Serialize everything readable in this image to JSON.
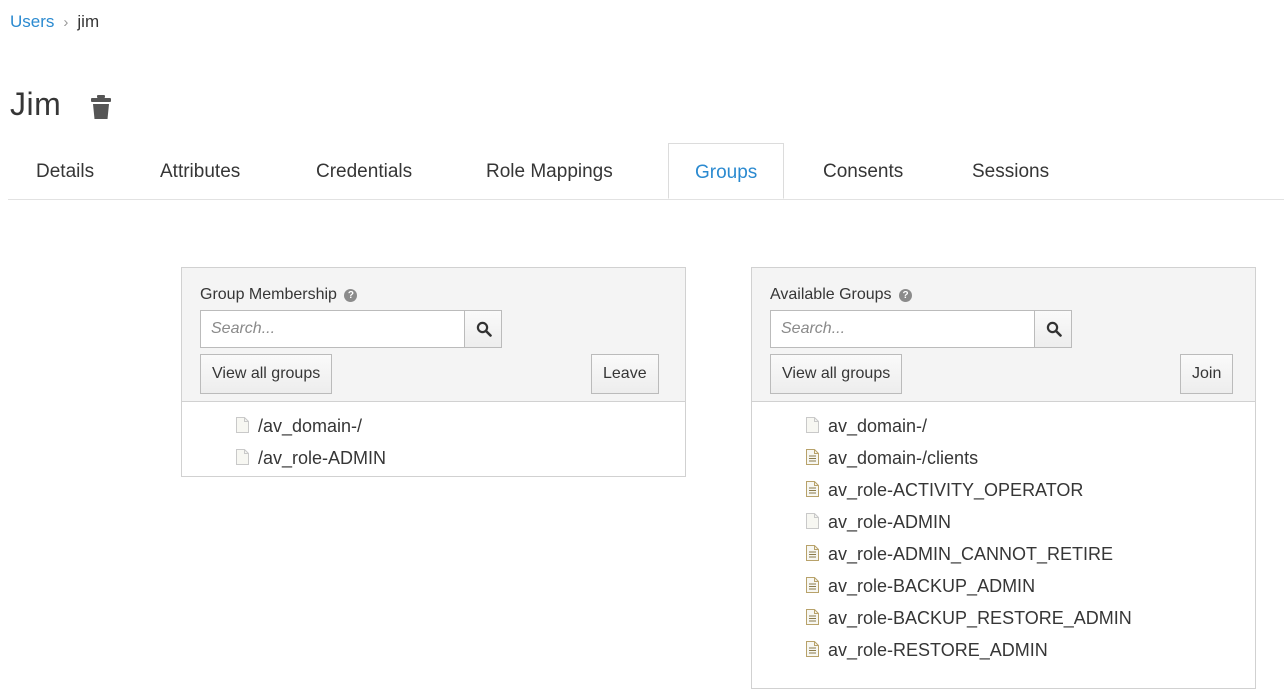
{
  "breadcrumb": {
    "parent": "Users",
    "separator": "›",
    "current": "jim"
  },
  "page": {
    "title": "Jim"
  },
  "tabs": [
    {
      "label": "Details"
    },
    {
      "label": "Attributes"
    },
    {
      "label": "Credentials"
    },
    {
      "label": "Role Mappings"
    },
    {
      "label": "Groups",
      "active": true
    },
    {
      "label": "Consents"
    },
    {
      "label": "Sessions"
    }
  ],
  "membership": {
    "title": "Group Membership",
    "help": "?",
    "search_placeholder": "Search...",
    "view_all_label": "View all groups",
    "action_label": "Leave",
    "items": [
      {
        "label": "/av_domain-/",
        "icon": "file-blank-icon"
      },
      {
        "label": "/av_role-ADMIN",
        "icon": "file-blank-icon"
      }
    ]
  },
  "available": {
    "title": "Available Groups",
    "help": "?",
    "search_placeholder": "Search...",
    "view_all_label": "View all groups",
    "action_label": "Join",
    "items": [
      {
        "label": "av_domain-/",
        "icon": "file-blank-icon"
      },
      {
        "label": "av_domain-/clients",
        "icon": "file-text-icon"
      },
      {
        "label": "av_role-ACTIVITY_OPERATOR",
        "icon": "file-text-icon"
      },
      {
        "label": "av_role-ADMIN",
        "icon": "file-blank-icon"
      },
      {
        "label": "av_role-ADMIN_CANNOT_RETIRE",
        "icon": "file-text-icon"
      },
      {
        "label": "av_role-BACKUP_ADMIN",
        "icon": "file-text-icon"
      },
      {
        "label": "av_role-BACKUP_RESTORE_ADMIN",
        "icon": "file-text-icon"
      },
      {
        "label": "av_role-RESTORE_ADMIN",
        "icon": "file-text-icon"
      }
    ]
  },
  "colors": {
    "link": "#2b8ad0",
    "text": "#363636",
    "panel_header": "#f4f4f4",
    "border": "#d1d1d1"
  }
}
